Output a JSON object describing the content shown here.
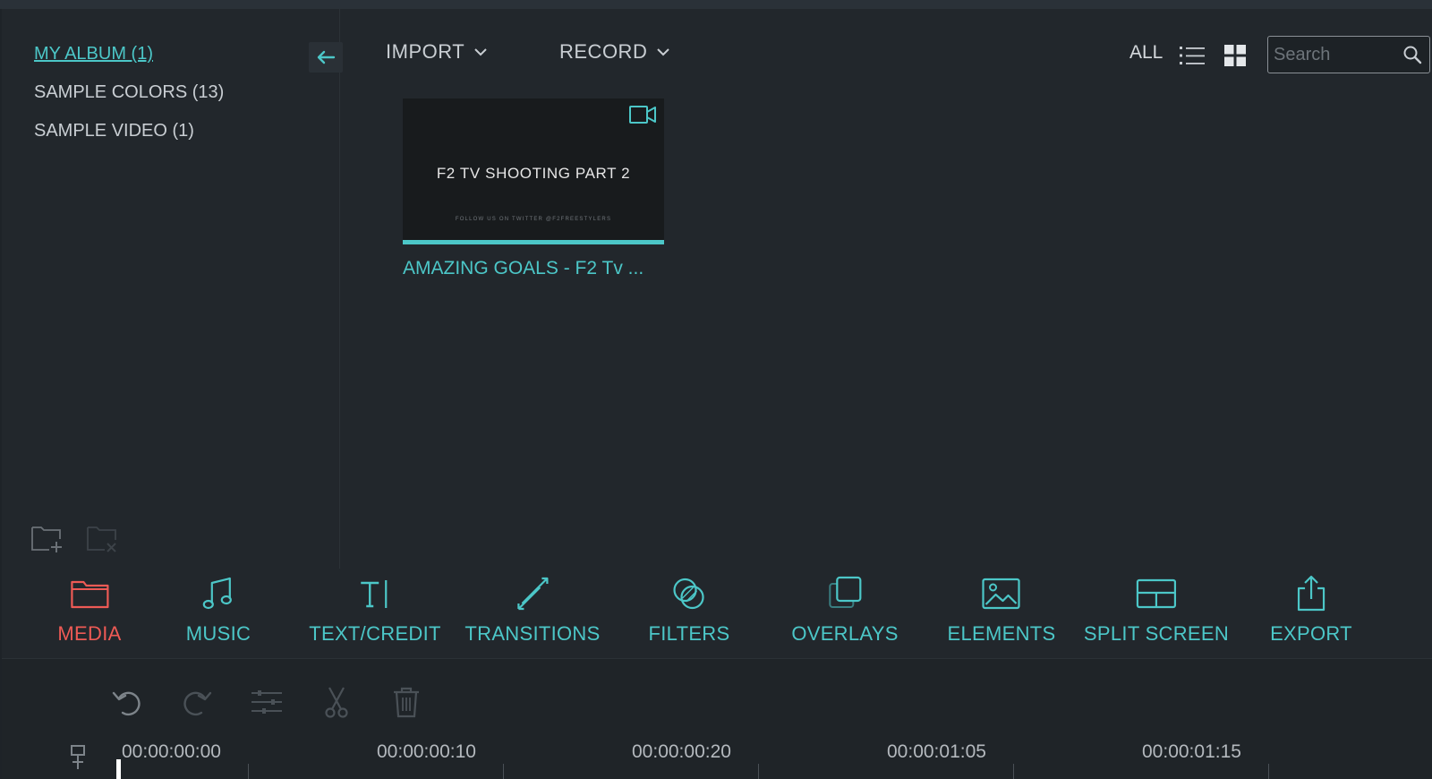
{
  "albums": [
    {
      "label": "MY ALBUM (1)",
      "active": true
    },
    {
      "label": "SAMPLE COLORS (13)",
      "active": false
    },
    {
      "label": "SAMPLE VIDEO (1)",
      "active": false
    }
  ],
  "toolbar": {
    "import_label": "IMPORT",
    "record_label": "RECORD",
    "all_label": "ALL",
    "search_placeholder": "Search"
  },
  "media_items": [
    {
      "name": "AMAZING GOALS - F2 Tv ...",
      "thumb_title": "F2 TV SHOOTING PART 2",
      "thumb_subtitle": "FOLLOW US ON TWITTER @F2FREESTYLERS"
    }
  ],
  "categories": [
    {
      "label": "MEDIA",
      "icon": "folder-icon",
      "active": true
    },
    {
      "label": "MUSIC",
      "icon": "music-note-icon",
      "active": false
    },
    {
      "label": "TEXT/CREDIT",
      "icon": "text-icon",
      "active": false
    },
    {
      "label": "TRANSITIONS",
      "icon": "transitions-icon",
      "active": false
    },
    {
      "label": "FILTERS",
      "icon": "filters-icon",
      "active": false
    },
    {
      "label": "OVERLAYS",
      "icon": "overlays-icon",
      "active": false
    },
    {
      "label": "ELEMENTS",
      "icon": "image-icon",
      "active": false
    },
    {
      "label": "SPLIT SCREEN",
      "icon": "split-screen-icon",
      "active": false
    },
    {
      "label": "EXPORT",
      "icon": "export-icon",
      "active": false
    }
  ],
  "timeline": {
    "timecodes": [
      "00:00:00:00",
      "00:00:00:10",
      "00:00:00:20",
      "00:00:01:05",
      "00:00:01:15"
    ]
  },
  "colors": {
    "accent": "#4cc7c8",
    "active": "#ee5a55",
    "background": "#22272c"
  }
}
